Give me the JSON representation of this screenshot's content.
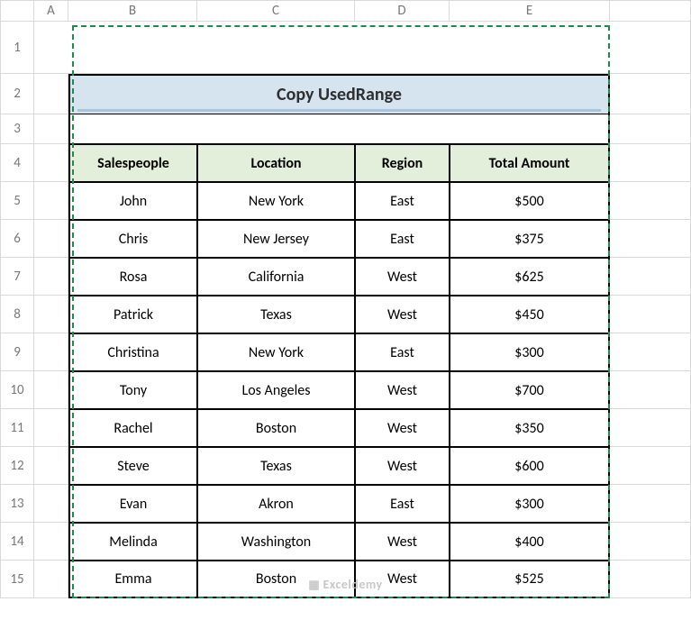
{
  "columns": [
    "A",
    "B",
    "C",
    "D",
    "E",
    ""
  ],
  "rows": [
    "1",
    "2",
    "3",
    "4",
    "5",
    "6",
    "7",
    "8",
    "9",
    "10",
    "11",
    "12",
    "13",
    "14",
    "15"
  ],
  "title": "Copy UsedRange",
  "headers": {
    "salespeople": "Salespeople",
    "location": "Location",
    "region": "Region",
    "total": "Total Amount"
  },
  "data": [
    {
      "sp": "John",
      "loc": "New York",
      "reg": "East",
      "amt": "$500"
    },
    {
      "sp": "Chris",
      "loc": "New Jersey",
      "reg": "East",
      "amt": "$375"
    },
    {
      "sp": "Rosa",
      "loc": "California",
      "reg": "West",
      "amt": "$625"
    },
    {
      "sp": "Patrick",
      "loc": "Texas",
      "reg": "West",
      "amt": "$450"
    },
    {
      "sp": "Christina",
      "loc": "New York",
      "reg": "East",
      "amt": "$300"
    },
    {
      "sp": "Tony",
      "loc": "Los Angeles",
      "reg": "West",
      "amt": "$700"
    },
    {
      "sp": "Rachel",
      "loc": "Boston",
      "reg": "West",
      "amt": "$350"
    },
    {
      "sp": "Steve",
      "loc": "Texas",
      "reg": "West",
      "amt": "$600"
    },
    {
      "sp": "Evan",
      "loc": "Akron",
      "reg": "East",
      "amt": "$300"
    },
    {
      "sp": "Melinda",
      "loc": "Washington",
      "reg": "West",
      "amt": "$400"
    },
    {
      "sp": "Emma",
      "loc": "Boston",
      "reg": "West",
      "amt": "$525"
    }
  ],
  "watermark": "Exceldemy"
}
